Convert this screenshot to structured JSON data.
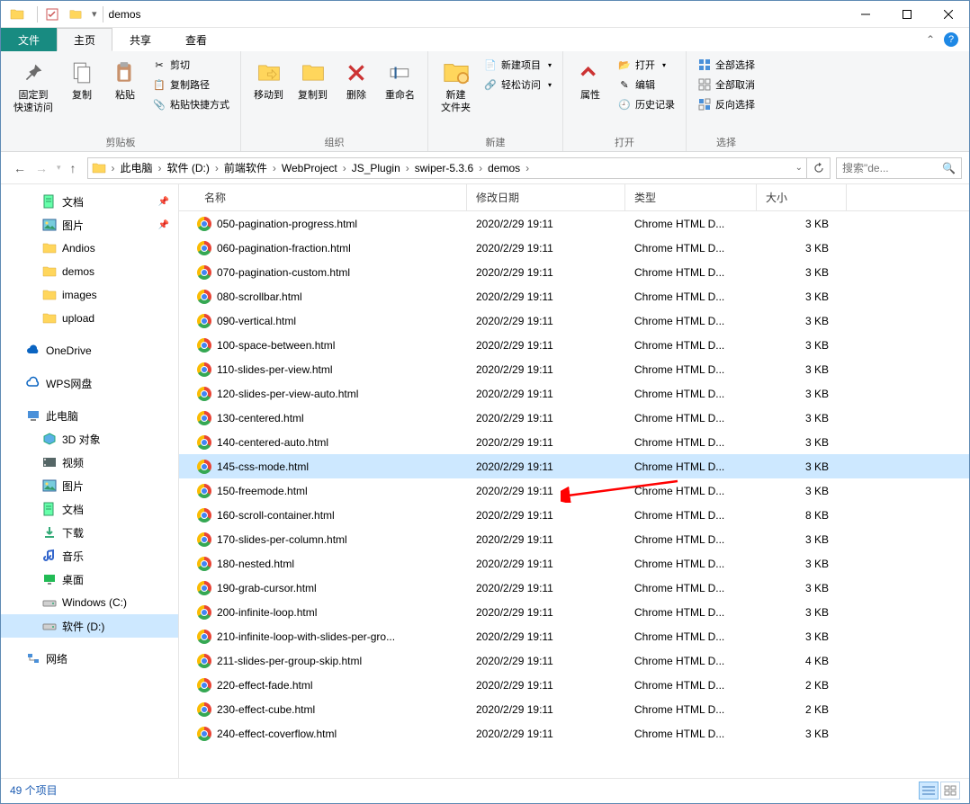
{
  "window": {
    "title": "demos"
  },
  "tabs": {
    "file": "文件",
    "home": "主页",
    "share": "共享",
    "view": "查看"
  },
  "ribbon": {
    "clipboard": {
      "label": "剪贴板",
      "pin": "固定到\n快速访问",
      "copy": "复制",
      "paste": "粘贴",
      "cut": "剪切",
      "copypath": "复制路径",
      "pasteshortcut": "粘贴快捷方式"
    },
    "organize": {
      "label": "组织",
      "moveto": "移动到",
      "copyto": "复制到",
      "delete": "删除",
      "rename": "重命名"
    },
    "new": {
      "label": "新建",
      "newfolder": "新建\n文件夹",
      "newitem": "新建项目",
      "easyaccess": "轻松访问"
    },
    "open": {
      "label": "打开",
      "properties": "属性",
      "open": "打开",
      "edit": "编辑",
      "history": "历史记录"
    },
    "select": {
      "label": "选择",
      "selectall": "全部选择",
      "selectnone": "全部取消",
      "invert": "反向选择"
    }
  },
  "breadcrumb": [
    "此电脑",
    "软件 (D:)",
    "前端软件",
    "WebProject",
    "JS_Plugin",
    "swiper-5.3.6",
    "demos"
  ],
  "search": {
    "placeholder": "搜索\"de..."
  },
  "sidebar": {
    "quick": [
      {
        "label": "文档",
        "icon": "doc",
        "pin": true
      },
      {
        "label": "图片",
        "icon": "pic",
        "pin": true
      },
      {
        "label": "Andios",
        "icon": "folder"
      },
      {
        "label": "demos",
        "icon": "folder"
      },
      {
        "label": "images",
        "icon": "folder"
      },
      {
        "label": "upload",
        "icon": "folder"
      }
    ],
    "onedrive": "OneDrive",
    "wps": "WPS网盘",
    "thispc": {
      "label": "此电脑",
      "items": [
        {
          "label": "3D 对象",
          "icon": "3d"
        },
        {
          "label": "视频",
          "icon": "video"
        },
        {
          "label": "图片",
          "icon": "pic"
        },
        {
          "label": "文档",
          "icon": "doc"
        },
        {
          "label": "下载",
          "icon": "download"
        },
        {
          "label": "音乐",
          "icon": "music"
        },
        {
          "label": "桌面",
          "icon": "desktop"
        },
        {
          "label": "Windows (C:)",
          "icon": "drive"
        },
        {
          "label": "软件 (D:)",
          "icon": "drive",
          "selected": true
        }
      ]
    },
    "network": "网络"
  },
  "columns": {
    "name": "名称",
    "date": "修改日期",
    "type": "类型",
    "size": "大小"
  },
  "files": [
    {
      "name": "050-pagination-progress.html",
      "date": "2020/2/29 19:11",
      "type": "Chrome HTML D...",
      "size": "3 KB"
    },
    {
      "name": "060-pagination-fraction.html",
      "date": "2020/2/29 19:11",
      "type": "Chrome HTML D...",
      "size": "3 KB"
    },
    {
      "name": "070-pagination-custom.html",
      "date": "2020/2/29 19:11",
      "type": "Chrome HTML D...",
      "size": "3 KB"
    },
    {
      "name": "080-scrollbar.html",
      "date": "2020/2/29 19:11",
      "type": "Chrome HTML D...",
      "size": "3 KB"
    },
    {
      "name": "090-vertical.html",
      "date": "2020/2/29 19:11",
      "type": "Chrome HTML D...",
      "size": "3 KB"
    },
    {
      "name": "100-space-between.html",
      "date": "2020/2/29 19:11",
      "type": "Chrome HTML D...",
      "size": "3 KB"
    },
    {
      "name": "110-slides-per-view.html",
      "date": "2020/2/29 19:11",
      "type": "Chrome HTML D...",
      "size": "3 KB"
    },
    {
      "name": "120-slides-per-view-auto.html",
      "date": "2020/2/29 19:11",
      "type": "Chrome HTML D...",
      "size": "3 KB"
    },
    {
      "name": "130-centered.html",
      "date": "2020/2/29 19:11",
      "type": "Chrome HTML D...",
      "size": "3 KB"
    },
    {
      "name": "140-centered-auto.html",
      "date": "2020/2/29 19:11",
      "type": "Chrome HTML D...",
      "size": "3 KB"
    },
    {
      "name": "145-css-mode.html",
      "date": "2020/2/29 19:11",
      "type": "Chrome HTML D...",
      "size": "3 KB",
      "selected": true
    },
    {
      "name": "150-freemode.html",
      "date": "2020/2/29 19:11",
      "type": "Chrome HTML D...",
      "size": "3 KB"
    },
    {
      "name": "160-scroll-container.html",
      "date": "2020/2/29 19:11",
      "type": "Chrome HTML D...",
      "size": "8 KB"
    },
    {
      "name": "170-slides-per-column.html",
      "date": "2020/2/29 19:11",
      "type": "Chrome HTML D...",
      "size": "3 KB"
    },
    {
      "name": "180-nested.html",
      "date": "2020/2/29 19:11",
      "type": "Chrome HTML D...",
      "size": "3 KB"
    },
    {
      "name": "190-grab-cursor.html",
      "date": "2020/2/29 19:11",
      "type": "Chrome HTML D...",
      "size": "3 KB"
    },
    {
      "name": "200-infinite-loop.html",
      "date": "2020/2/29 19:11",
      "type": "Chrome HTML D...",
      "size": "3 KB"
    },
    {
      "name": "210-infinite-loop-with-slides-per-gro...",
      "date": "2020/2/29 19:11",
      "type": "Chrome HTML D...",
      "size": "3 KB"
    },
    {
      "name": "211-slides-per-group-skip.html",
      "date": "2020/2/29 19:11",
      "type": "Chrome HTML D...",
      "size": "4 KB"
    },
    {
      "name": "220-effect-fade.html",
      "date": "2020/2/29 19:11",
      "type": "Chrome HTML D...",
      "size": "2 KB"
    },
    {
      "name": "230-effect-cube.html",
      "date": "2020/2/29 19:11",
      "type": "Chrome HTML D...",
      "size": "2 KB"
    },
    {
      "name": "240-effect-coverflow.html",
      "date": "2020/2/29 19:11",
      "type": "Chrome HTML D...",
      "size": "3 KB"
    }
  ],
  "status": {
    "count": "49 个项目"
  }
}
